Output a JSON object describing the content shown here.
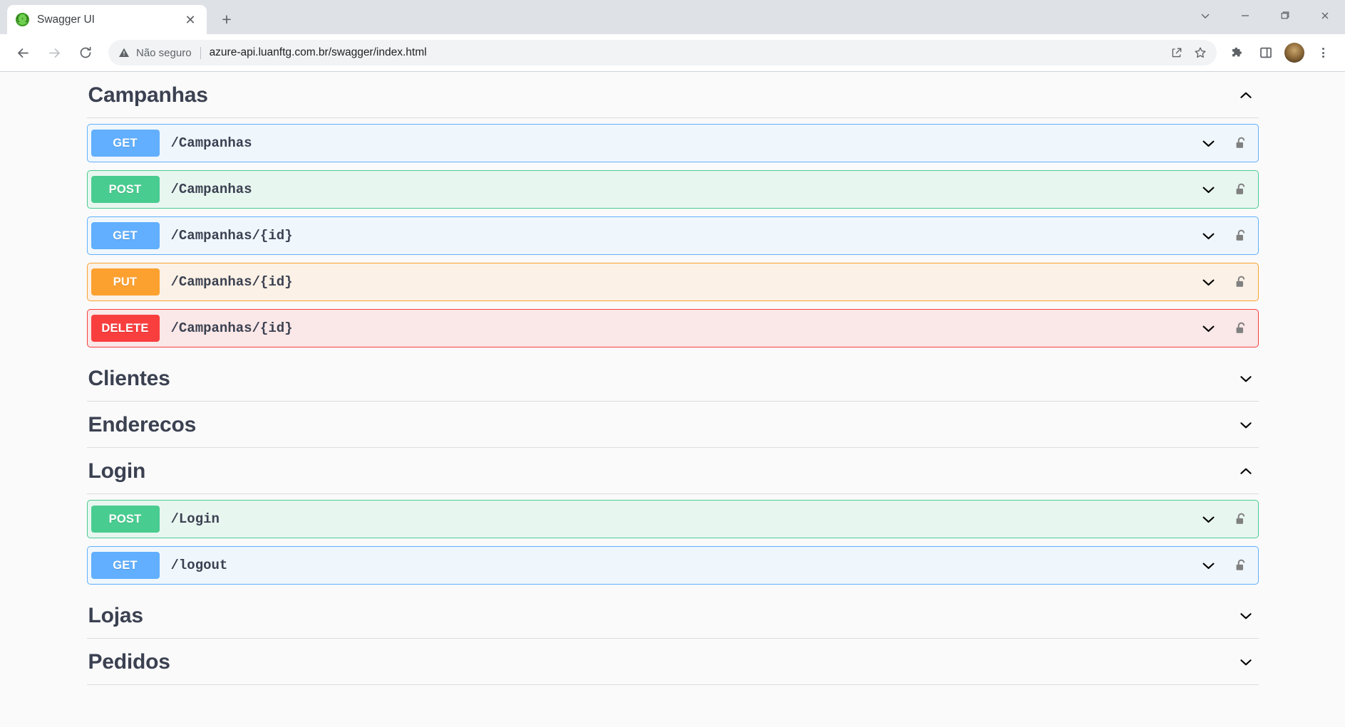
{
  "browser": {
    "tab": {
      "title": "Swagger UI",
      "favicon_icon": "swagger-braces-icon",
      "favicon_glyph": "{·}",
      "close_icon": "close-icon",
      "close_glyph": "✕"
    },
    "new_tab_icon": "plus-icon",
    "new_tab_glyph": "+",
    "window_controls": [
      {
        "name": "tab-search-button",
        "icon": "chevron-down-icon"
      },
      {
        "name": "minimize-button",
        "icon": "minimize-icon"
      },
      {
        "name": "maximize-button",
        "icon": "maximize-icon"
      },
      {
        "name": "close-window-button",
        "icon": "close-icon"
      }
    ],
    "nav": {
      "back_icon": "arrow-left-icon",
      "forward_icon": "arrow-right-icon",
      "reload_icon": "reload-icon"
    },
    "omnibox": {
      "security_icon": "warning-triangle-icon",
      "security_label": "Não seguro",
      "url": "azure-api.luanftg.com.br/swagger/index.html",
      "share_icon": "share-icon",
      "bookmark_icon": "star-icon"
    },
    "toolbar_right": [
      {
        "name": "extensions-button",
        "icon": "puzzle-piece-icon"
      },
      {
        "name": "side-panel-button",
        "icon": "side-panel-icon"
      },
      {
        "name": "profile-avatar",
        "icon": "avatar-icon"
      },
      {
        "name": "chrome-menu-button",
        "icon": "kebab-menu-icon"
      }
    ]
  },
  "colors": {
    "get": "#61affe",
    "post": "#49cc90",
    "put": "#fca130",
    "delete": "#f93e3e",
    "get_bg": "#f0f7fc",
    "post_bg": "#e8f6f0",
    "put_bg": "#fbf1e6",
    "delete_bg": "#fae7e7",
    "title": "#3b4151",
    "page_bg": "#fafafa"
  },
  "swagger": {
    "sections": [
      {
        "title": "Campanhas",
        "expanded": true,
        "chevron_icon": "chevron-up-icon",
        "operations": [
          {
            "method": "GET",
            "method_class": "m-get",
            "path": "/Campanhas",
            "chevron_icon": "chevron-down-icon",
            "lock_icon": "unlocked-padlock-icon"
          },
          {
            "method": "POST",
            "method_class": "m-post",
            "path": "/Campanhas",
            "chevron_icon": "chevron-down-icon",
            "lock_icon": "unlocked-padlock-icon"
          },
          {
            "method": "GET",
            "method_class": "m-get",
            "path": "/Campanhas/{id}",
            "chevron_icon": "chevron-down-icon",
            "lock_icon": "unlocked-padlock-icon"
          },
          {
            "method": "PUT",
            "method_class": "m-put",
            "path": "/Campanhas/{id}",
            "chevron_icon": "chevron-down-icon",
            "lock_icon": "unlocked-padlock-icon"
          },
          {
            "method": "DELETE",
            "method_class": "m-delete",
            "path": "/Campanhas/{id}",
            "chevron_icon": "chevron-down-icon",
            "lock_icon": "unlocked-padlock-icon"
          }
        ]
      },
      {
        "title": "Clientes",
        "expanded": false,
        "chevron_icon": "chevron-down-icon",
        "operations": []
      },
      {
        "title": "Enderecos",
        "expanded": false,
        "chevron_icon": "chevron-down-icon",
        "operations": []
      },
      {
        "title": "Login",
        "expanded": true,
        "chevron_icon": "chevron-up-icon",
        "operations": [
          {
            "method": "POST",
            "method_class": "m-post",
            "path": "/Login",
            "chevron_icon": "chevron-down-icon",
            "lock_icon": "unlocked-padlock-icon"
          },
          {
            "method": "GET",
            "method_class": "m-get",
            "path": "/logout",
            "chevron_icon": "chevron-down-icon",
            "lock_icon": "unlocked-padlock-icon"
          }
        ]
      },
      {
        "title": "Lojas",
        "expanded": false,
        "chevron_icon": "chevron-down-icon",
        "operations": []
      },
      {
        "title": "Pedidos",
        "expanded": false,
        "chevron_icon": "chevron-down-icon",
        "operations": []
      }
    ]
  }
}
